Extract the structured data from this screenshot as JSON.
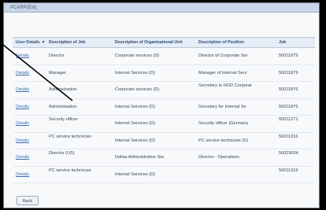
{
  "window": {
    "title": "PCARP(Ext)"
  },
  "table": {
    "columns": [
      "User Details",
      "Description of Job",
      "Description of Organizational Unit",
      "Description of Position",
      "Job"
    ],
    "rows": [
      {
        "link": "Details",
        "job": "Director",
        "org": "Corporate services (D)",
        "position": "Director of Corporate Ser",
        "id": "50011879",
        "two_line": false
      },
      {
        "link": "Details",
        "job": "Manager",
        "org": "Internal Services (D)",
        "position": "Manager of Internal Serv",
        "id": "50011879",
        "two_line": false
      },
      {
        "link": "Details",
        "job": "Administration",
        "org": "Corporate services (D)",
        "position": "Secretary to HOD Corporat",
        "id": "50011876",
        "two_line": false
      },
      {
        "link": "Details",
        "job": "Administration",
        "org": "Internal Services (D)",
        "position": "Secretary for Internal Se",
        "id": "50011876",
        "two_line": false
      },
      {
        "link": "Details",
        "job": "Security officer",
        "org": "Internal Services (D)",
        "position": "Security officer (Germany",
        "id": "50011271",
        "two_line": true
      },
      {
        "link": "Details",
        "job": "PC service technician",
        "org": "Internal Services (D)",
        "position": "PC service technician (D)",
        "id": "50011316",
        "two_line": true
      },
      {
        "link": "Details",
        "job": "Director (US)",
        "org": "Dallas Administrative Sta",
        "position": "Director - Operations",
        "id": "50029024",
        "two_line": true
      },
      {
        "link": "Details",
        "job": "PC service technician",
        "org": "Internal Services (D)",
        "position": "",
        "id": "50011316",
        "two_line": true
      }
    ]
  },
  "buttons": {
    "back": "Back"
  },
  "colors": {
    "header_bg": "#e6edf6",
    "link": "#3a6fb0"
  }
}
